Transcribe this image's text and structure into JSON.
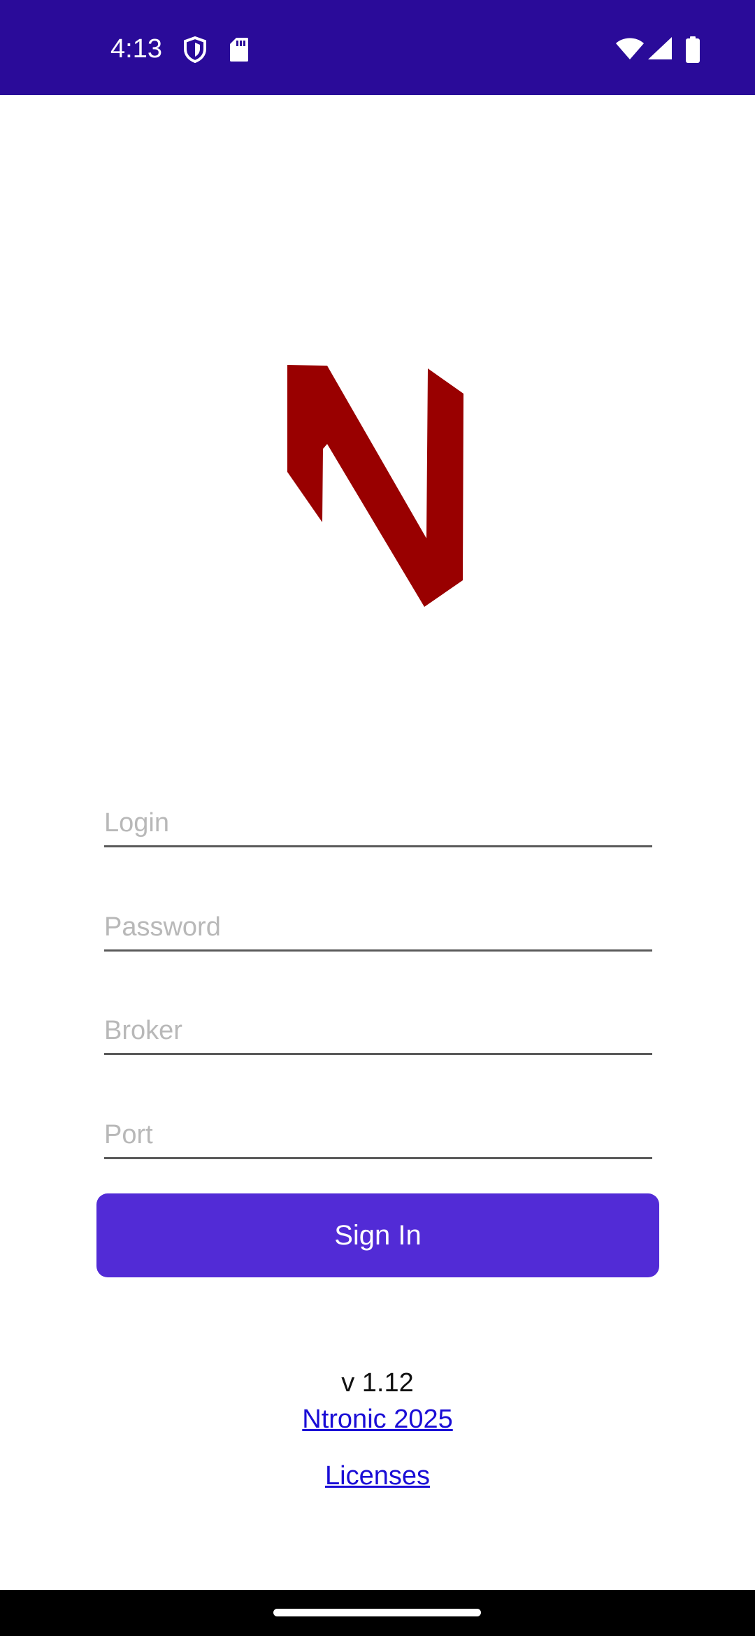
{
  "status_bar": {
    "time": "4:13",
    "background_color": "#2a0b99",
    "left_icons": [
      "shield-icon",
      "sd-card-icon"
    ],
    "right_icons": [
      "wifi-icon",
      "signal-icon",
      "battery-icon"
    ]
  },
  "logo": {
    "icon": "n-logo-icon",
    "color": "#990000"
  },
  "form": {
    "login_placeholder": "Login",
    "login_value": "",
    "password_placeholder": "Password",
    "password_value": "",
    "broker_placeholder": "Broker",
    "broker_value": "",
    "port_placeholder": "Port",
    "port_value": "",
    "sign_in_label": "Sign In",
    "button_color": "#522bd6"
  },
  "footer": {
    "version": "v 1.12",
    "company_link": "Ntronic 2025",
    "licenses_link": "Licenses",
    "link_color": "#1a0dd6"
  }
}
